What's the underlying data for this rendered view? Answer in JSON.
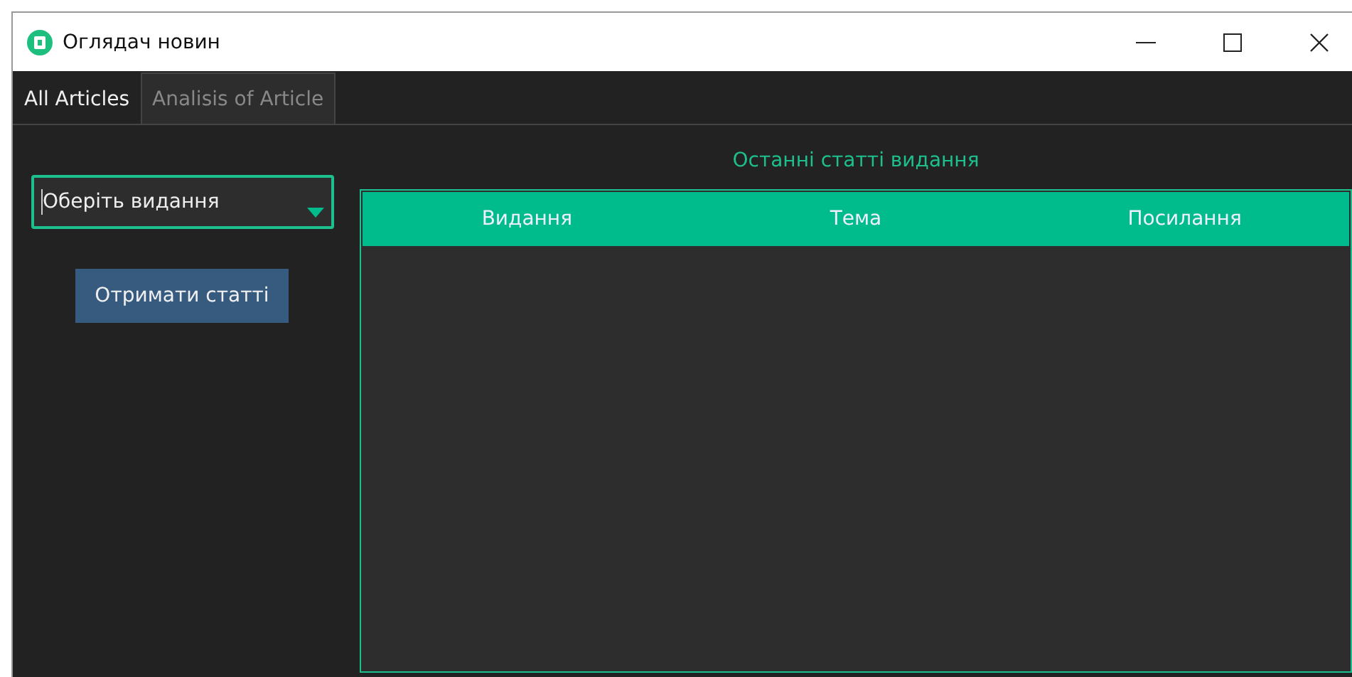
{
  "window": {
    "title": "Оглядач новин"
  },
  "tabs": [
    {
      "label": "All Articles",
      "selected": true
    },
    {
      "label": "Analisis of Article",
      "selected": false
    }
  ],
  "publication_select": {
    "value": "Оберіть видання"
  },
  "get_button": "Отримати статті",
  "table": {
    "title": "Останні статті видання",
    "columns": [
      "Видання",
      "Тема",
      "Посилання"
    ]
  }
}
